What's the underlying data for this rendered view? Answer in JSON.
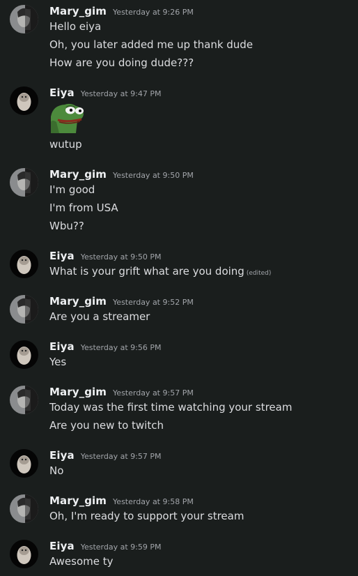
{
  "messages": [
    {
      "author": "Mary_gim",
      "time": "Yesterday at 9:26 PM",
      "lines": [
        "Hello eiya",
        "Oh, you later added me up thank dude",
        "How are you doing dude???"
      ]
    },
    {
      "author": "Eiya",
      "time": "Yesterday at 9:47 PM",
      "emoji": "pepe-emoji",
      "lines": [
        "wutup"
      ]
    },
    {
      "author": "Mary_gim",
      "time": "Yesterday at 9:50 PM",
      "lines": [
        "I'm good",
        "I'm from USA",
        "Wbu??"
      ]
    },
    {
      "author": "Eiya",
      "time": "Yesterday at 9:50 PM",
      "lines": [
        "What is your grift what are you doing"
      ],
      "edited": "(edited)"
    },
    {
      "author": "Mary_gim",
      "time": "Yesterday at 9:52 PM",
      "lines": [
        "Are you a streamer"
      ]
    },
    {
      "author": "Eiya",
      "time": "Yesterday at 9:56 PM",
      "lines": [
        "Yes"
      ]
    },
    {
      "author": "Mary_gim",
      "time": "Yesterday at 9:57 PM",
      "lines": [
        "Today was the first time watching your stream",
        "Are you new to twitch"
      ]
    },
    {
      "author": "Eiya",
      "time": "Yesterday at 9:57 PM",
      "lines": [
        "No"
      ]
    },
    {
      "author": "Mary_gim",
      "time": "Yesterday at 9:58 PM",
      "lines": [
        "Oh, I'm ready to support your stream"
      ]
    },
    {
      "author": "Eiya",
      "time": "Yesterday at 9:59 PM",
      "lines": [
        "Awesome ty"
      ]
    }
  ],
  "colors": {
    "background": "#1a1e1d",
    "username": "#eef0f2",
    "text": "#dcdde0",
    "muted": "#a2a5aa"
  }
}
